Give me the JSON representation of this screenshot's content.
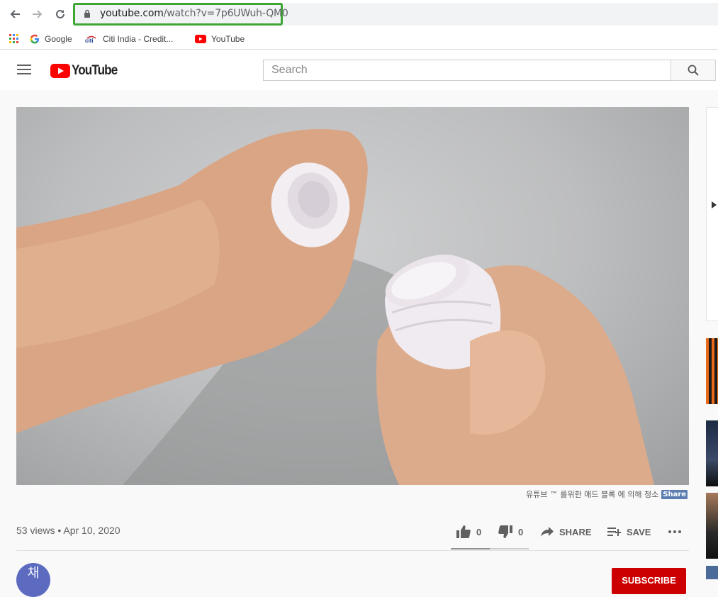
{
  "browser": {
    "url_host": "youtube.com",
    "url_path": "/watch?v=7p6UWuh-QM0",
    "bookmarks": [
      {
        "label": "Google",
        "icon": "google-icon"
      },
      {
        "label": "Citi India - Credit...",
        "icon": "citi-icon"
      },
      {
        "label": "YouTube",
        "icon": "youtube-icon"
      }
    ],
    "highlight_color": "#3fa535"
  },
  "header": {
    "logo_text": "YouTube",
    "search_placeholder": "Search"
  },
  "video": {
    "watermark_text": "유튜브 ™ 를위한 애드 블록 에 의해 청소",
    "watermark_share": "Share"
  },
  "meta": {
    "views_date": "53 views • Apr 10, 2020",
    "likes": "0",
    "dislikes": "0",
    "share_label": "SHARE",
    "save_label": "SAVE",
    "like_ratio": 0.5
  },
  "channel": {
    "avatar_initial": "채",
    "subscribe_label": "SUBSCRIBE"
  },
  "colors": {
    "brand_red": "#ff0000",
    "subscribe_red": "#cc0000"
  }
}
